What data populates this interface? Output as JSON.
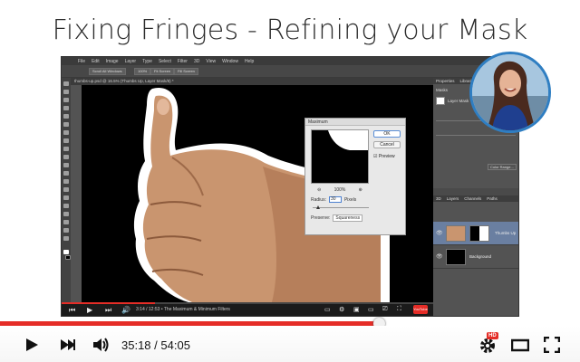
{
  "slide": {
    "title": "Fixing Fringes - Refining your Mask"
  },
  "photoshop": {
    "menu": [
      "PS",
      "File",
      "Edit",
      "Image",
      "Layer",
      "Type",
      "Select",
      "Filter",
      "3D",
      "View",
      "Window",
      "Help"
    ],
    "options": {
      "scroll_all": "Scroll All Windows",
      "zoom": "100%",
      "fit_screen": "Fit Screen",
      "fill_screen": "Fill Screen"
    },
    "doc_tab": "thumbs-up.psd @ 16.5% (Thumbs Up, Layer Mask/8) *",
    "dialog": {
      "title": "Maximum",
      "ok": "OK",
      "cancel": "Cancel",
      "preview": "Preview",
      "zoom": "100%",
      "radius_label": "Radius:",
      "radius_value": "30",
      "radius_unit": "Pixels",
      "preserve_label": "Preserve:",
      "preserve_value": "Squareness"
    },
    "panels": {
      "top_tabs": [
        "Properties",
        "Libraries"
      ],
      "properties_items": [
        "Masks",
        "Layer Mask"
      ],
      "layers_tabs": [
        "3D",
        "Layers",
        "Channels",
        "Paths"
      ],
      "layers": [
        {
          "name": "Thumbs Up",
          "active": true
        },
        {
          "name": "Background",
          "active": false
        }
      ],
      "color_range": "Color Range..."
    },
    "status": {
      "time": "3:14 / 12:53",
      "chapter": "• The Maximum & Minimum Filters",
      "inner_progress": 0.25,
      "youtube_label": "YouTube"
    }
  },
  "player": {
    "current_time": "35:18",
    "duration": "54:05",
    "time_display": "35:18 / 54:05",
    "played_fraction": 0.653,
    "loaded_fraction": 1.0,
    "hd_badge": "HD",
    "accent_color": "#e52d27"
  }
}
